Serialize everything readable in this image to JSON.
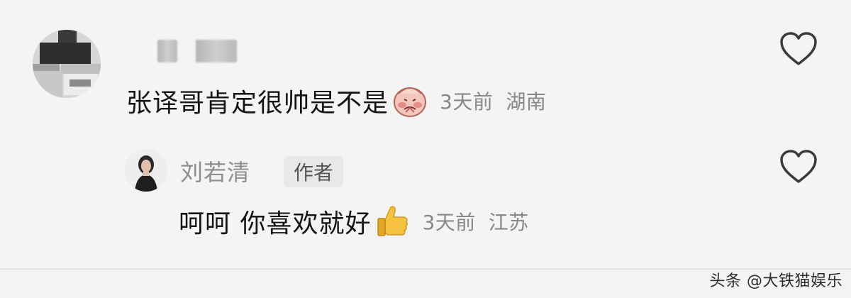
{
  "comment": {
    "text": "张译哥肯定很帅是不是",
    "time": "3天前",
    "location": "湖南"
  },
  "reply": {
    "username": "刘若清",
    "badge": "作者",
    "text": "呵呵 你喜欢就好",
    "time": "3天前",
    "location": "江苏"
  },
  "watermark": "头条 @大铁猫娱乐",
  "colors": {
    "background": "#f4f4f4",
    "primary_text": "#141414",
    "meta_text": "#888888",
    "badge_bg": "#e8e8e8"
  },
  "icons": {
    "like": "heart-outline-icon",
    "comment_emoji": "blushing-face-emoji",
    "reply_emoji": "thumbs-up-emoji"
  }
}
